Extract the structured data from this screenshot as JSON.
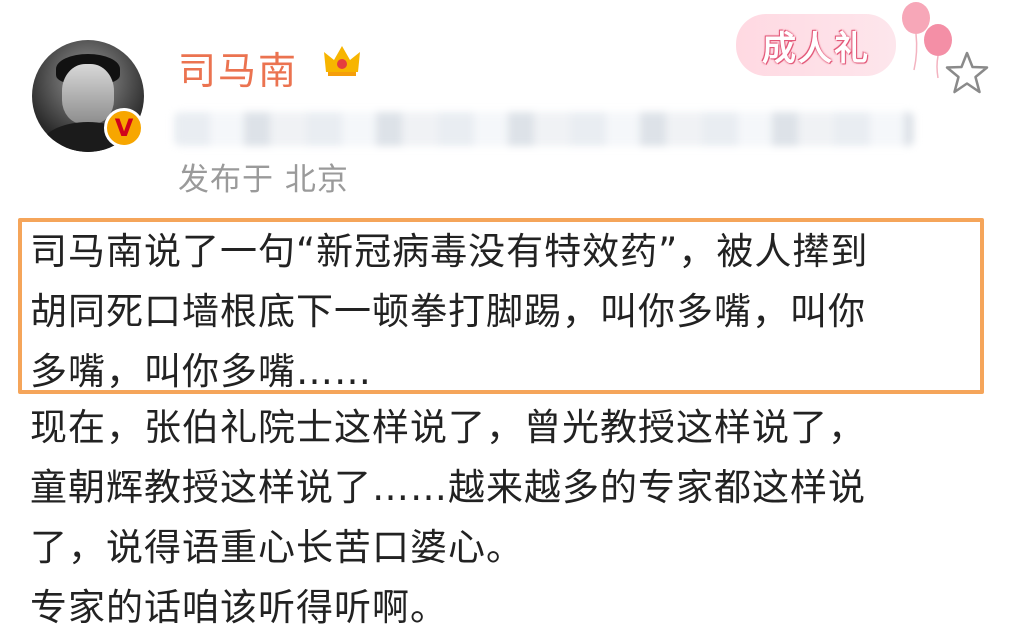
{
  "header": {
    "username": "司马南",
    "location_line": "发布于 北京",
    "ceremony_badge": "成人礼"
  },
  "post": {
    "highlighted_lines": [
      "司马南说了一句“新冠病毒没有特效药”，被人撵到",
      "胡同死口墙根底下一顿拳打脚踢，叫你多嘴，叫你",
      "多嘴，叫你多嘴……"
    ],
    "body_lines": [
      "现在，张伯礼院士这样说了，曾光教授这样说了，",
      "童朝辉教授这样说了……越来越多的专家都这样说",
      "了，说得语重心长苦口婆心。",
      "专家的话咱该听得听啊。"
    ]
  },
  "icons": {
    "avatar": "avatar-photo",
    "verify": "verified-badge-icon",
    "crown": "crown-icon",
    "balloons": "balloon-icon",
    "star": "star-icon"
  },
  "colors": {
    "username": "#eb7350",
    "highlight_border": "#f5a55a",
    "location": "#9a9a9a"
  }
}
